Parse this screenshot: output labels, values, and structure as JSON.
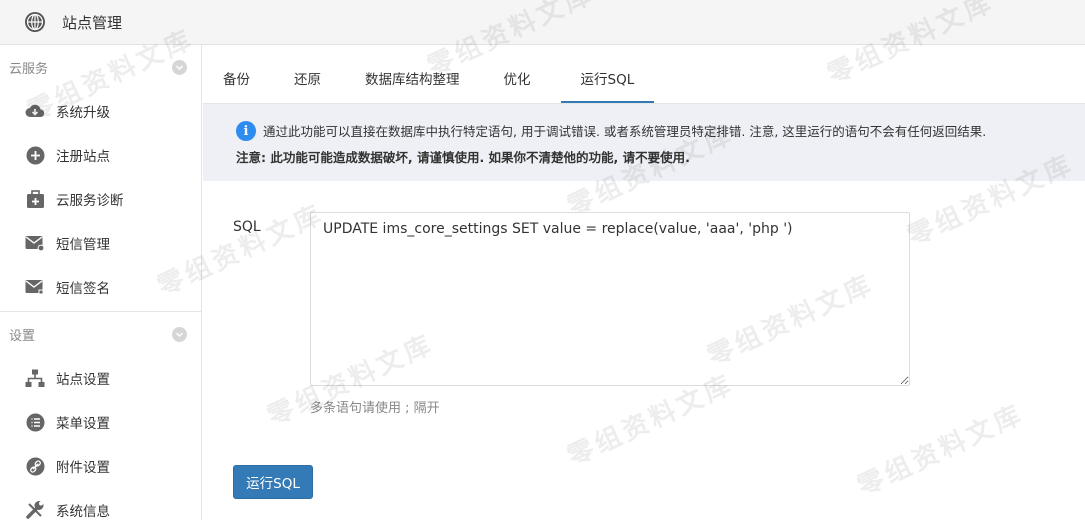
{
  "header": {
    "title": "站点管理",
    "icon": "globe-icon"
  },
  "sidebar": {
    "groups": [
      {
        "label": "云服务",
        "items": [
          {
            "label": "系统升级",
            "icon": "cloud-download-icon"
          },
          {
            "label": "注册站点",
            "icon": "plus-circle-icon"
          },
          {
            "label": "云服务诊断",
            "icon": "medkit-icon"
          },
          {
            "label": "短信管理",
            "icon": "mail-gear-icon"
          },
          {
            "label": "短信签名",
            "icon": "mail-pen-icon"
          }
        ]
      },
      {
        "label": "设置",
        "items": [
          {
            "label": "站点设置",
            "icon": "sitemap-icon"
          },
          {
            "label": "菜单设置",
            "icon": "list-icon"
          },
          {
            "label": "附件设置",
            "icon": "link-icon"
          },
          {
            "label": "系统信息",
            "icon": "wrench-icon"
          }
        ]
      }
    ]
  },
  "tabs": [
    {
      "label": "备份"
    },
    {
      "label": "还原"
    },
    {
      "label": "数据库结构整理"
    },
    {
      "label": "优化"
    },
    {
      "label": "运行SQL",
      "active": true
    }
  ],
  "notice": {
    "line1": "通过此功能可以直接在数据库中执行特定语句, 用于调试错误. 或者系统管理员特定排错. 注意, 这里运行的语句不会有任何返回结果.",
    "line2": "注意: 此功能可能造成数据破坏, 请谨慎使用. 如果你不清楚他的功能, 请不要使用."
  },
  "form": {
    "label": "SQL",
    "sql_value": "UPDATE ims_core_settings SET value = replace(value, 'aaa', 'php ')",
    "help": "多条语句请使用 ; 隔开",
    "submit_label": "运行SQL"
  },
  "watermark_text": "零组资料文库",
  "colors": {
    "primary": "#337ab7",
    "info": "#2d8cf0",
    "notice_bg": "#eef0f5"
  }
}
